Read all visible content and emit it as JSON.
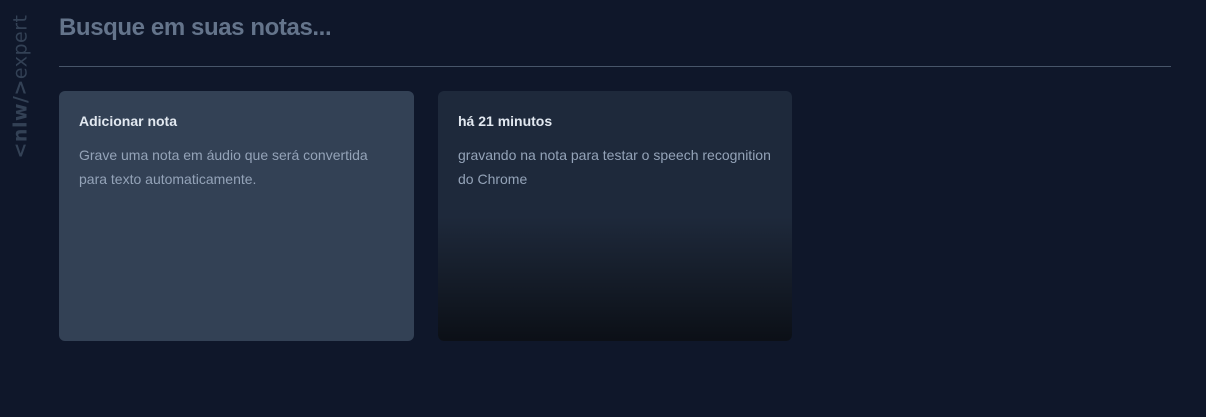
{
  "logo": {
    "text_left": "<nlw/>",
    "text_right": "expert"
  },
  "search": {
    "placeholder": "Busque em suas notas...",
    "value": ""
  },
  "add_card": {
    "title": "Adicionar nota",
    "description": "Grave uma nota em áudio que será convertida para texto automaticamente."
  },
  "notes": [
    {
      "date": "há 21 minutos",
      "content": "gravando na nota para testar o speech recognition do Chrome"
    }
  ],
  "colors": {
    "background": "#0f172a",
    "add_card_background": "#334155",
    "note_card_background": "#1e293b",
    "title_text": "#e2e8f0",
    "body_text": "#94a3b8",
    "placeholder_text": "#64748b",
    "divider": "#475569"
  }
}
